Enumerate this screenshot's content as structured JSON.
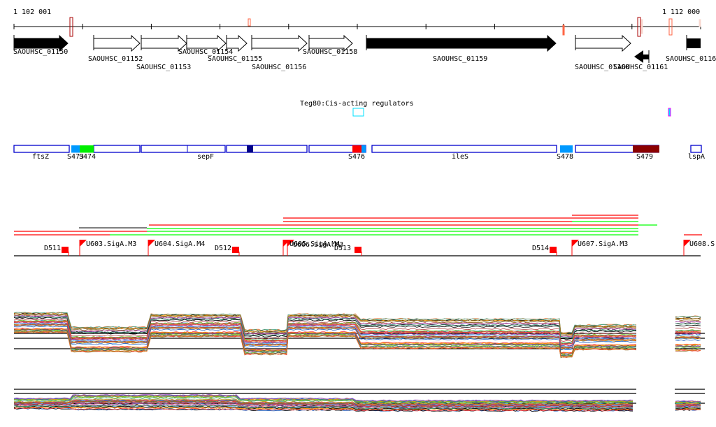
{
  "ruler": {
    "start_label": "1 102 001",
    "end_label": "1 112 000"
  },
  "genes": [
    {
      "name": "SAOUHSC_01150",
      "strand": "+",
      "filled": true
    },
    {
      "name": "SAOUHSC_01152",
      "strand": "+",
      "filled": false
    },
    {
      "name": "SAOUHSC_01153",
      "strand": "+",
      "filled": false
    },
    {
      "name": "SAOUHSC_01154",
      "strand": "+",
      "filled": false
    },
    {
      "name": "SAOUHSC_01155",
      "strand": "+",
      "filled": false
    },
    {
      "name": "SAOUHSC_01156",
      "strand": "+",
      "filled": false
    },
    {
      "name": "SAOUHSC_01158",
      "strand": "+",
      "filled": false
    },
    {
      "name": "SAOUHSC_01159",
      "strand": "+",
      "filled": true
    },
    {
      "name": "SAOUHSC_01160",
      "strand": "+",
      "filled": false
    },
    {
      "name": "SAOUHSC_01161",
      "strand": "-",
      "filled": true
    },
    {
      "name": "SAOUHSC_0116",
      "strand": "+",
      "filled": true
    }
  ],
  "regulator": {
    "label": "Teg80:Cis-acting regulators"
  },
  "regions": [
    {
      "label": "ftsZ"
    },
    {
      "label": "S473"
    },
    {
      "label": "S474"
    },
    {
      "label": "sepF"
    },
    {
      "label": "S476"
    },
    {
      "label": "ileS"
    },
    {
      "label": "S478"
    },
    {
      "label": "S479"
    },
    {
      "label": "lspA"
    }
  ],
  "promoters": [
    {
      "label": "D511"
    },
    {
      "label": "U603.SigA.M3"
    },
    {
      "label": "U604.SigA.M4"
    },
    {
      "label": "D512"
    },
    {
      "label": "U605.SigA.M4"
    },
    {
      "label": "U606.SigA.M3"
    },
    {
      "label": "D513"
    },
    {
      "label": "D514"
    },
    {
      "label": "U607.SigA.M3"
    },
    {
      "label": "U608.S"
    }
  ],
  "colors": {
    "accent_red": "#ff0000",
    "accent_green": "#00ff00",
    "region_border": "#0000cc",
    "marker_dark": "#aa0000",
    "marker_light": "#ff6644"
  },
  "series_palette": [
    "#e07030",
    "#8b6b2a",
    "#c03080",
    "#70c020",
    "#2060c0",
    "#000000",
    "#ff4040",
    "#60b0ff",
    "#a050c0",
    "#d0a020",
    "#40a080",
    "#b04040",
    "#ff9900",
    "#555555"
  ]
}
